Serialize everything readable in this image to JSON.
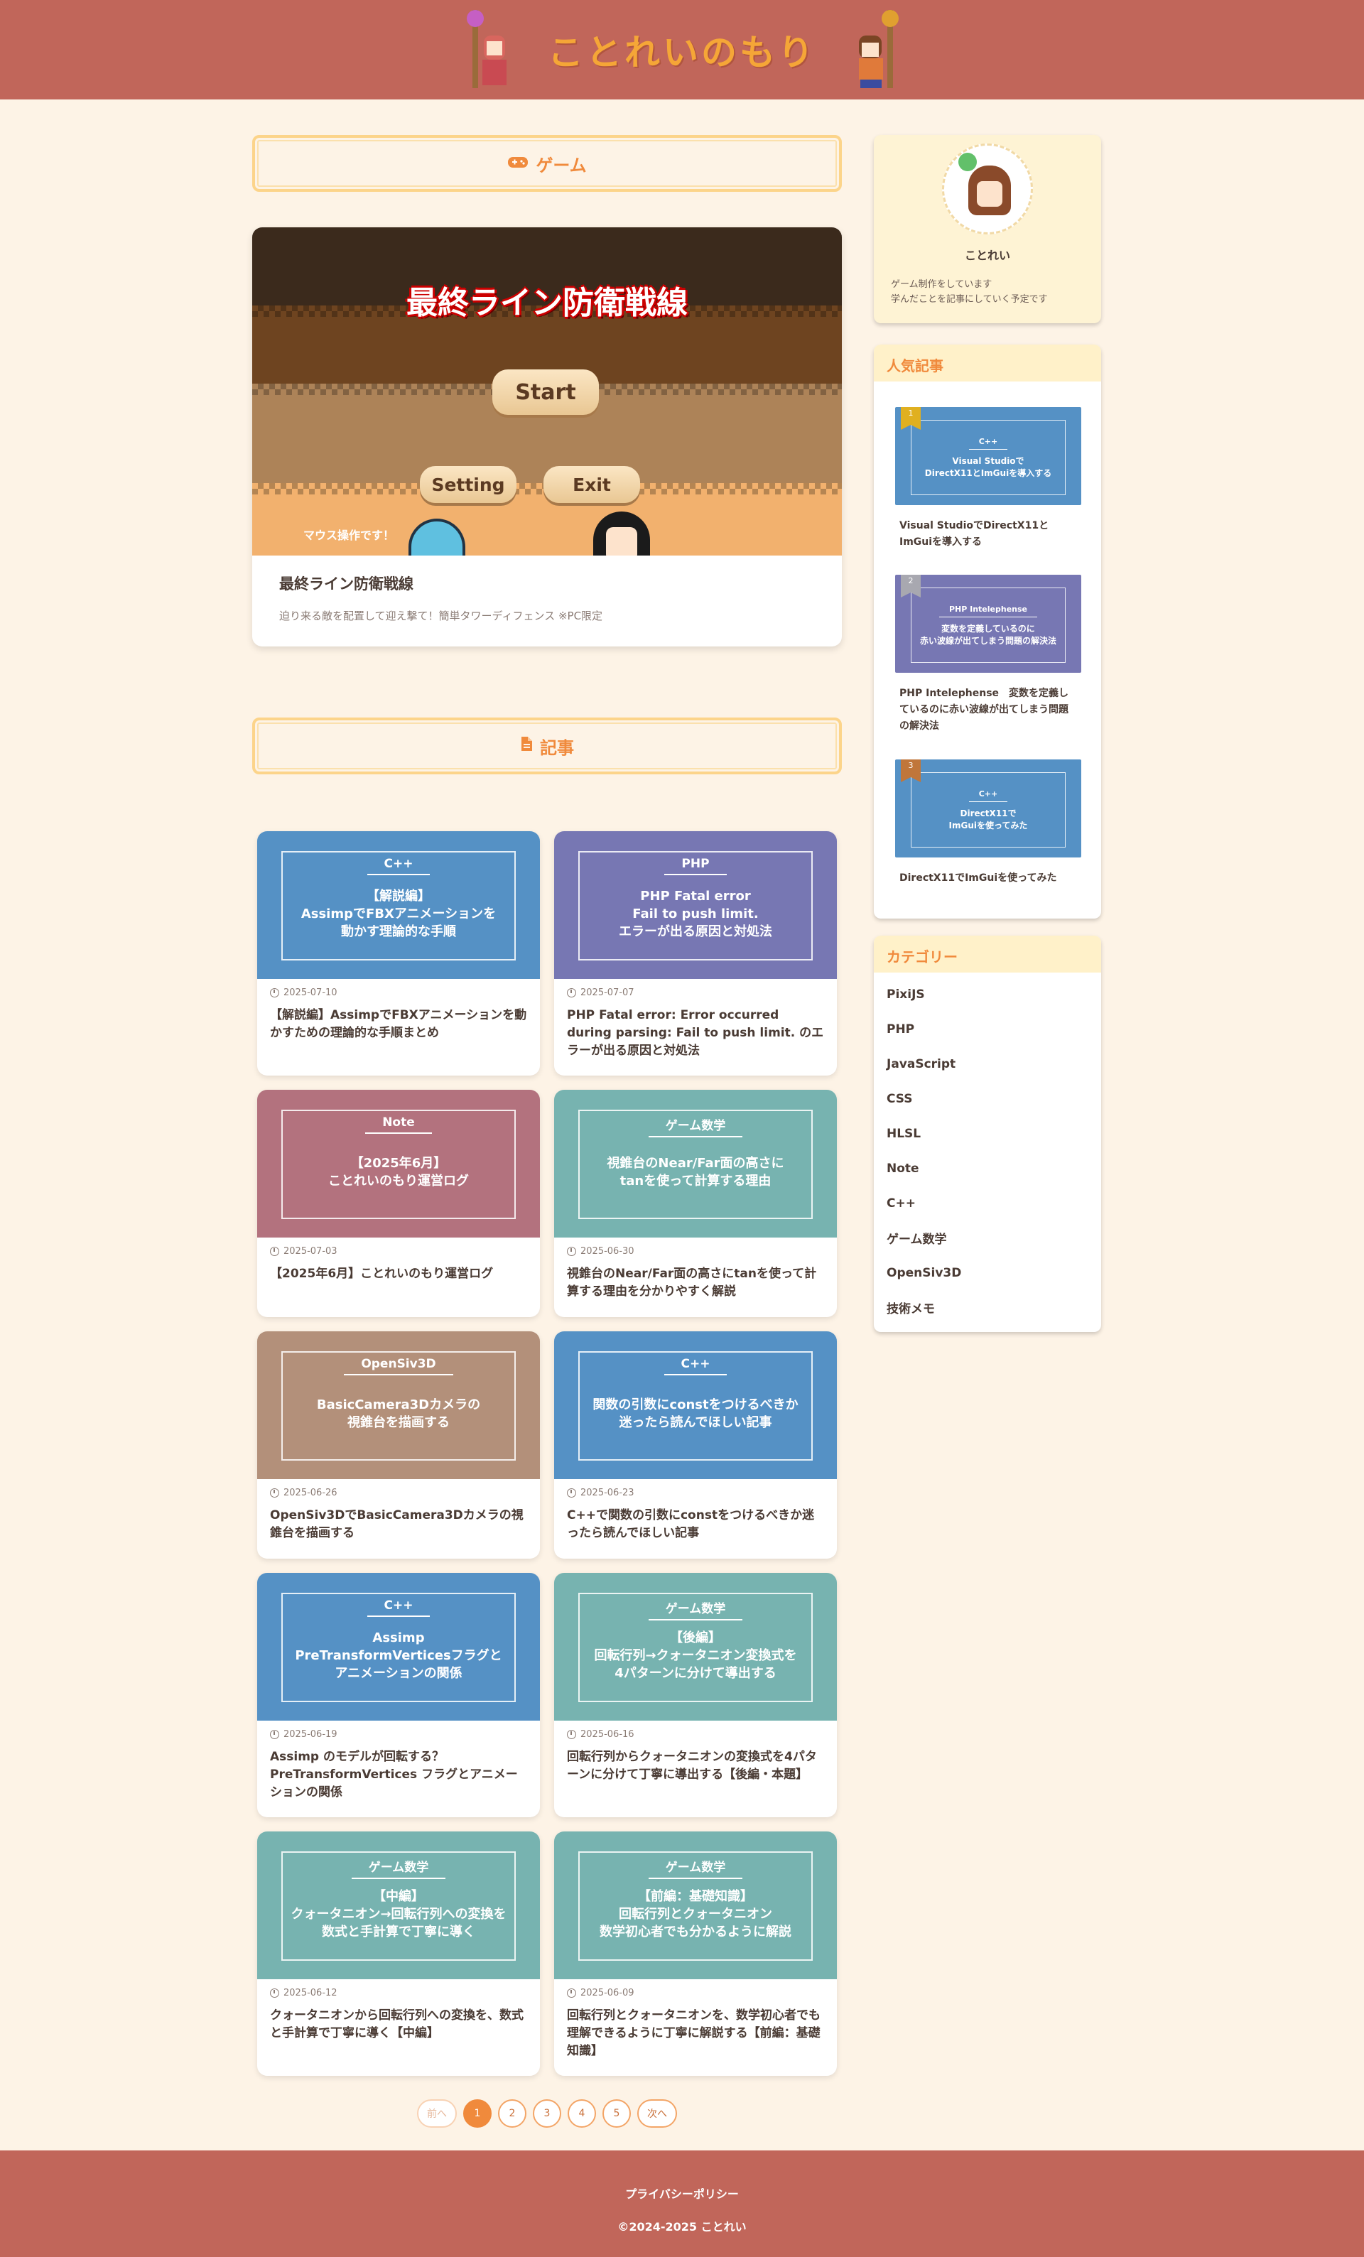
{
  "header": {
    "site_title": "ことれいのもり"
  },
  "game_section": {
    "heading": "ゲーム",
    "screenshot": {
      "logo_text": "最終ライン防衛戦線",
      "start_label": "Start",
      "setting_label": "Setting",
      "exit_label": "Exit",
      "note": "マウス操作です！"
    },
    "title": "最終ライン防衛戦線",
    "description": "迫り来る敵を配置して迎え撃て！簡単タワーディフェンス ※PC限定"
  },
  "article_section": {
    "heading": "記事"
  },
  "articles": [
    {
      "category": "C++",
      "thumb_text": "【解説編】\nAssimpでFBXアニメーションを\n動かす理論的な手順",
      "date": "2025-07-10",
      "title": "【解説編】AssimpでFBXアニメーションを動かすための理論的な手順まとめ",
      "color": "#5591c5"
    },
    {
      "category": "PHP",
      "thumb_text": "PHP Fatal error\nFail to push limit.\nエラーが出る原因と対処法",
      "date": "2025-07-07",
      "title": "PHP Fatal error: Error occurred during parsing: Fail to push limit. のエラーが出る原因と対処法",
      "color": "#7777b3"
    },
    {
      "category": "Note",
      "thumb_text": "【2025年6月】\nことれいのもり運営ログ",
      "date": "2025-07-03",
      "title": "【2025年6月】ことれいのもり運営ログ",
      "color": "#b3727e"
    },
    {
      "category": "ゲーム数学",
      "thumb_text": "視錐台のNear/Far面の高さに\ntanを使って計算する理由",
      "date": "2025-06-30",
      "title": "視錐台のNear/Far面の高さにtanを使って計算する理由を分かりやすく解説",
      "color": "#77b3b0"
    },
    {
      "category": "OpenSiv3D",
      "thumb_text": "BasicCamera3Dカメラの\n視錐台を描画する",
      "date": "2025-06-26",
      "title": "OpenSiv3DでBasicCamera3Dカメラの視錐台を描画する",
      "color": "#b3907a"
    },
    {
      "category": "C++",
      "thumb_text": "関数の引数にconstをつけるべきか\n迷ったら読んでほしい記事",
      "date": "2025-06-23",
      "title": "C++で関数の引数にconstをつけるべきか迷ったら読んでほしい記事",
      "color": "#5591c5"
    },
    {
      "category": "C++",
      "thumb_text": "Assimp\nPreTransformVerticesフラグと\nアニメーションの関係",
      "date": "2025-06-19",
      "title": "Assimp のモデルが回転する？PreTransformVertices フラグとアニメーションの関係",
      "color": "#5591c5"
    },
    {
      "category": "ゲーム数学",
      "thumb_text": "【後編】\n回転行列→クォータニオン変換式を\n4パターンに分けて導出する",
      "date": "2025-06-16",
      "title": "回転行列からクォータニオンの変換式を4パターンに分けて丁寧に導出する【後編・本題】",
      "color": "#77b3b0"
    },
    {
      "category": "ゲーム数学",
      "thumb_text": "【中編】\nクォータニオン→回転行列への変換を\n数式と手計算で丁寧に導く",
      "date": "2025-06-12",
      "title": "クォータニオンから回転行列への変換を、数式と手計算で丁寧に導く【中編】",
      "color": "#77b3b0"
    },
    {
      "category": "ゲーム数学",
      "thumb_text": "【前編：基礎知識】\n回転行列とクォータニオン\n数学初心者でも分かるように解説",
      "date": "2025-06-09",
      "title": "回転行列とクォータニオンを、数学初心者でも理解できるように丁寧に解説する【前編：基礎知識】",
      "color": "#77b3b0"
    }
  ],
  "pagination": {
    "prev": "前へ",
    "pages": [
      "1",
      "2",
      "3",
      "4",
      "5"
    ],
    "next": "次へ",
    "current": "1"
  },
  "profile": {
    "name": "ことれい",
    "bio": "ゲーム制作をしています\n学んだことを記事にしていく予定です"
  },
  "popular": {
    "heading": "人気記事",
    "items": [
      {
        "rank": "1",
        "category": "C++",
        "thumb_text": "Visual Studioで\nDirectX11とImGuiを導入する",
        "title": "Visual StudioでDirectX11とImGuiを導入する",
        "color": "#5591c5",
        "rank_color": "#e0b020"
      },
      {
        "rank": "2",
        "category": "PHP Intelephense",
        "thumb_text": "変数を定義しているのに\n赤い波線が出てしまう問題の解決法",
        "title": "PHP Intelephense　変数を定義しているのに赤い波線が出てしまう問題の解決法",
        "color": "#7777b3",
        "rank_color": "#a8a8b0"
      },
      {
        "rank": "3",
        "category": "C++",
        "thumb_text": "DirectX11で\nImGuiを使ってみた",
        "title": "DirectX11でImGuiを使ってみた",
        "color": "#5591c5",
        "rank_color": "#c0763a"
      }
    ]
  },
  "categories": {
    "heading": "カテゴリー",
    "items": [
      "PixiJS",
      "PHP",
      "JavaScript",
      "CSS",
      "HLSL",
      "Note",
      "C++",
      "ゲーム数学",
      "OpenSiv3D",
      "技術メモ"
    ]
  },
  "footer": {
    "privacy_link": "プライバシーポリシー",
    "copyright": "©2024-2025 ことれい"
  }
}
